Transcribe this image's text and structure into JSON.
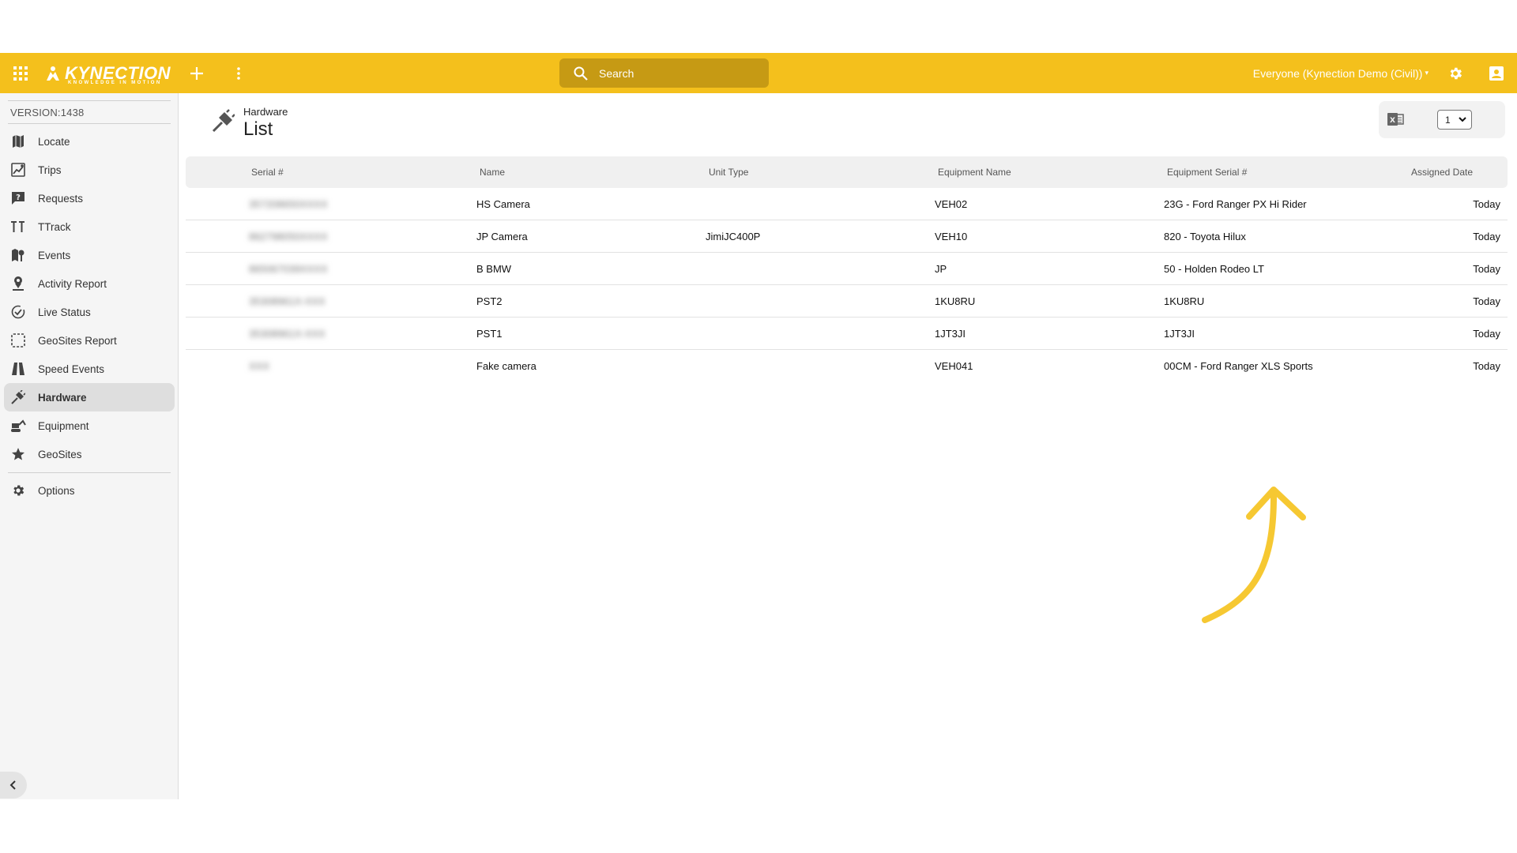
{
  "topbar": {
    "logo_text": "KYNECTION",
    "logo_tagline": "KNOWLEDGE IN MOTION",
    "search_placeholder": "Search",
    "scope_label": "Everyone (Kynection Demo (Civil))",
    "accent_color": "#f4c01c",
    "icons": [
      "apps-grid-icon",
      "add-icon",
      "more-vertical-icon",
      "search-icon",
      "gear-icon",
      "account-icon"
    ]
  },
  "sidebar": {
    "version": "VERSION:1438",
    "items": [
      {
        "label": "Locate",
        "icon": "map-icon"
      },
      {
        "label": "Trips",
        "icon": "trips-icon"
      },
      {
        "label": "Requests",
        "icon": "request-icon"
      },
      {
        "label": "TTrack",
        "icon": "ttrack-icon"
      },
      {
        "label": "Events",
        "icon": "events-icon"
      },
      {
        "label": "Activity Report",
        "icon": "person-pin-icon"
      },
      {
        "label": "Live Status",
        "icon": "check-circle-icon"
      },
      {
        "label": "GeoSites Report",
        "icon": "dashed-square-icon"
      },
      {
        "label": "Speed Events",
        "icon": "road-icon"
      },
      {
        "label": "Hardware",
        "icon": "plug-icon",
        "active": true
      },
      {
        "label": "Equipment",
        "icon": "excavator-icon"
      },
      {
        "label": "GeoSites",
        "icon": "star-icon"
      }
    ],
    "options_label": "Options"
  },
  "page": {
    "overline": "Hardware",
    "title": "List",
    "page_select_value": "1"
  },
  "table": {
    "columns": [
      "Serial #",
      "Name",
      "Unit Type",
      "Equipment Name",
      "Equipment Serial #",
      "Assigned Date"
    ],
    "rows": [
      {
        "serial": "357208650XXXX",
        "name": "HS Camera",
        "unit_type": "",
        "equipment_name": "VEH02",
        "equipment_serial": "23G - Ford Ranger PX Hi Rider",
        "assigned_date": "Today"
      },
      {
        "serial": "862798050XXXX",
        "name": "JP Camera",
        "unit_type": "JimiJC400P",
        "equipment_name": "VEH10",
        "equipment_serial": "820 - Toyota Hilux",
        "assigned_date": "Today"
      },
      {
        "serial": "865067039XXXX",
        "name": "B BMW",
        "unit_type": "",
        "equipment_name": "JP",
        "equipment_serial": "50 - Holden Rodeo LT",
        "assigned_date": "Today"
      },
      {
        "serial": "35308961X-XXX",
        "name": "PST2",
        "unit_type": "",
        "equipment_name": "1KU8RU",
        "equipment_serial": "1KU8RU",
        "assigned_date": "Today"
      },
      {
        "serial": "35308961X-XXX",
        "name": "PST1",
        "unit_type": "",
        "equipment_name": "1JT3JI",
        "equipment_serial": "1JT3JI",
        "assigned_date": "Today"
      },
      {
        "serial": "XXX",
        "name": "Fake camera",
        "unit_type": "",
        "equipment_name": "VEH041",
        "equipment_serial": "00CM - Ford Ranger XLS Sports",
        "assigned_date": "Today"
      }
    ]
  },
  "annotation": {
    "color": "#f6c832"
  }
}
